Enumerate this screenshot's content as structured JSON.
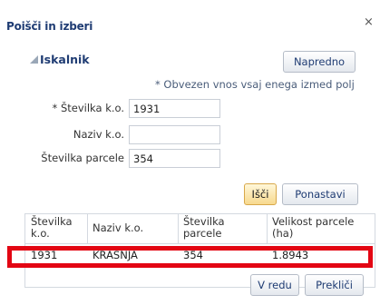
{
  "dialog": {
    "title": "Poišči in izberi",
    "close_glyph": "×"
  },
  "search": {
    "section_title": "Iskalnik",
    "advanced_button": "Napredno",
    "required_hint": "* Obvezen vnos vsaj enega izmed polj",
    "fields": {
      "stevilka_ko": {
        "label": "* Številka k.o.",
        "value": "1931"
      },
      "naziv_ko": {
        "label": "Naziv k.o.",
        "value": ""
      },
      "stevilka_parcele": {
        "label": "Številka parcele",
        "value": "354"
      }
    },
    "search_button": "Išči",
    "reset_button": "Ponastavi"
  },
  "results": {
    "columns": [
      "Številka k.o.",
      "Naziv k.o.",
      "Številka parcele",
      "Velikost parcele (ha)"
    ],
    "rows": [
      [
        "1931",
        "KRAŠNJA",
        "354",
        "1.8943"
      ]
    ],
    "selected_row": 0,
    "highlight_color": "#e30613"
  },
  "footer": {
    "ok_button": "V redu",
    "cancel_button": "Prekliči"
  }
}
